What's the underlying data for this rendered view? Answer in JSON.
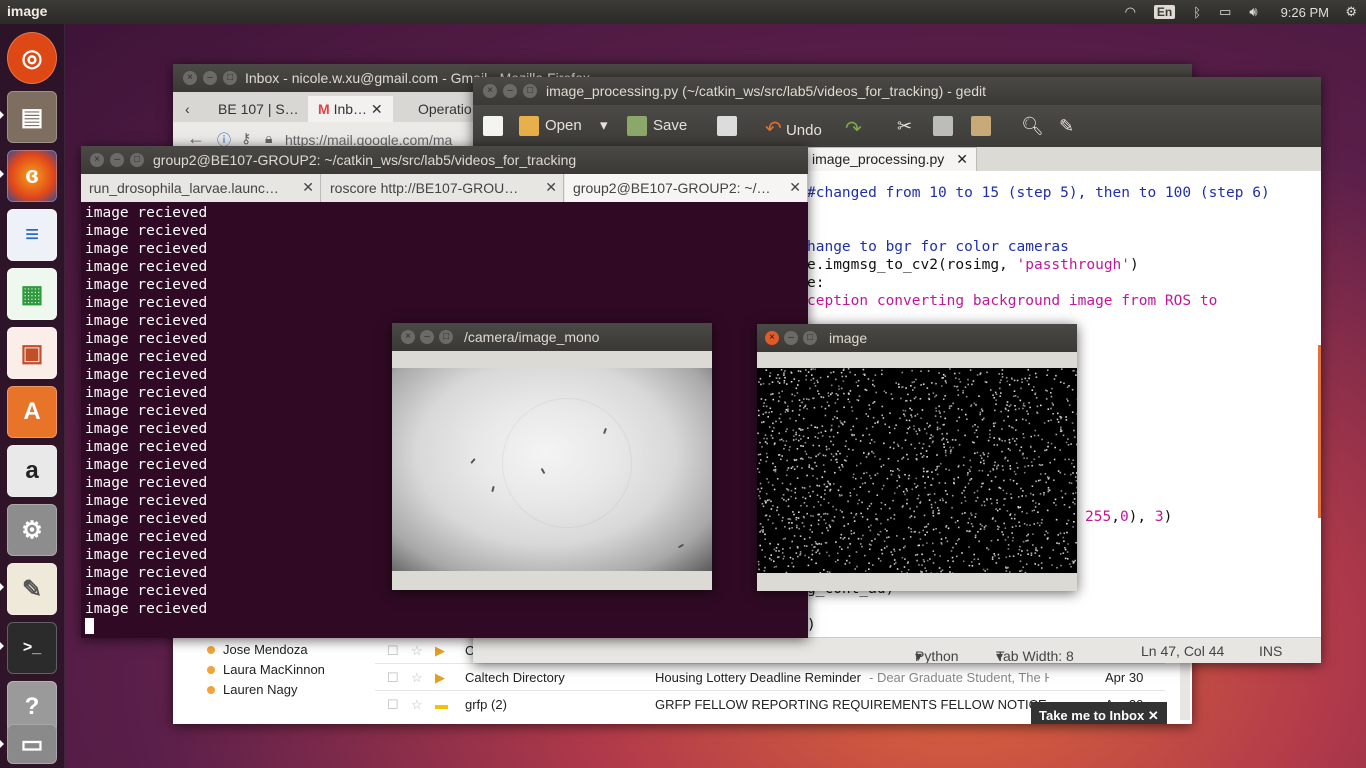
{
  "top_panel": {
    "app_title": "image",
    "keyboard_layout": "En",
    "clock": "9:26 PM"
  },
  "launcher": {
    "items": [
      {
        "name": "ubuntu-dash-icon",
        "color": "#dd4814"
      },
      {
        "name": "files-icon",
        "color": "#8a7a68"
      },
      {
        "name": "firefox-icon",
        "color": "#e66000"
      },
      {
        "name": "libreoffice-writer-icon",
        "color": "#2a6ac4"
      },
      {
        "name": "libreoffice-calc-icon",
        "color": "#2f9a3c"
      },
      {
        "name": "libreoffice-impress-icon",
        "color": "#c0502a"
      },
      {
        "name": "software-center-icon",
        "color": "#e8742a"
      },
      {
        "name": "amazon-icon",
        "color": "#555555"
      },
      {
        "name": "system-settings-icon",
        "color": "#9a9a9a"
      },
      {
        "name": "text-editor-icon",
        "color": "#e8e2d4"
      },
      {
        "name": "terminal-icon",
        "color": "#2b2b2b"
      },
      {
        "name": "help-icon",
        "color": "#a0a0a0"
      },
      {
        "name": "scanner-icon",
        "color": "#8a8a8a"
      }
    ]
  },
  "firefox": {
    "title": "Inbox - nicole.w.xu@gmail.com - Gmail - Mozilla Firefox",
    "tabs": [
      "BE 107 | S…",
      "Inb…",
      "Operatio"
    ],
    "url": "https://mail.google.com/ma",
    "contacts": [
      "Jose Mendoza",
      "Laura MacKinnon",
      "Lauren Nagy"
    ],
    "mail_rows": [
      {
        "sender": "C",
        "subject": "",
        "snippet": "",
        "date": ""
      },
      {
        "sender": "Caltech Directory",
        "subject": "Housing Lottery Deadline Reminder",
        "snippet": " - Dear Graduate Student, The Ho",
        "date": "Apr 30"
      },
      {
        "sender": "grfp (2)",
        "subject": "GRFP FELLOW REPORTING REQUIREMENTS FELLOW NOTICE",
        "snippet": "",
        "date": "Apr 30"
      }
    ],
    "take_me_to_inbox": "Take me to Inbox"
  },
  "gedit": {
    "title": "image_processing.py (~/catkin_ws/src/lab5/videos_for_tracking) - gedit",
    "toolbar": {
      "open": "Open",
      "save": "Save",
      "undo": "Undo"
    },
    "tab_label": "image_processing.py",
    "code": {
      "line1": "#changed from 10 to 15 (step 5), then to 100 (step 6)",
      "line2": "hange to bgr for color cameras",
      "line3a": "e.imgmsg_to_cv2(rosimg, ",
      "line3b": "'passthrough'",
      "line3c": ")",
      "line4": "e:",
      "line5": "ception converting background image from ROS to",
      "line6a": "255",
      "line6b": ",",
      "line6c": "0",
      "line6d": "), ",
      "line6e": "3",
      "line6f": ")",
      "line7": "g_cont_ad)",
      "line8": ")"
    },
    "status": {
      "language": "Python",
      "tab_width": "Tab Width: 8",
      "position": "Ln 47, Col 44",
      "mode": "INS"
    }
  },
  "terminal": {
    "title": "group2@BE107-GROUP2: ~/catkin_ws/src/lab5/videos_for_tracking",
    "tabs": [
      "run_drosophila_larvae.launc…",
      "roscore http://BE107-GROU…",
      "group2@BE107-GROUP2: ~/…"
    ],
    "lines": [
      "image recieved",
      "image recieved",
      "image recieved",
      "image recieved",
      "image recieved",
      "image recieved",
      "image recieved",
      "image recieved",
      "image recieved",
      "image recieved",
      "image recieved",
      "image recieved",
      "image recieved",
      "image recieved",
      "image recieved",
      "image recieved",
      "image recieved",
      "image recieved",
      "image recieved",
      "image recieved",
      "image recieved",
      "image recieved",
      "image recieved"
    ]
  },
  "camera_window": {
    "title": "/camera/image_mono"
  },
  "image_window": {
    "title": "image"
  }
}
